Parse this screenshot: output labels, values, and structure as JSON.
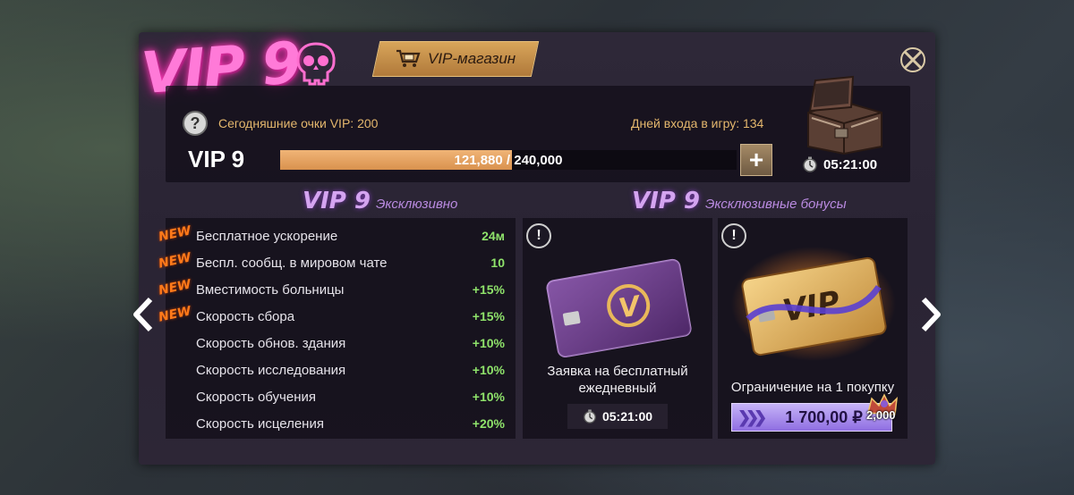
{
  "header": {
    "vip_logo_text": "VIP 9",
    "shop_label": "VIP-магазин"
  },
  "status": {
    "today_points": "Сегодняшние очки VIP: 200",
    "login_days": "Дней входа в игру: 134",
    "vip_level": "VIP 9",
    "progress_text": "121,880 / 240,000",
    "progress_fraction": 0.508,
    "plus_label": "+",
    "chest_timer": "05:21:00"
  },
  "exclusive": {
    "title_big": "VIP 9",
    "title_small": "Эксклюзивно",
    "new_label": "NEW",
    "rows": [
      {
        "name": "Бесплатное ускорение",
        "value": "24м",
        "is_new": true
      },
      {
        "name": "Беспл. сообщ. в мировом чате",
        "value": "10",
        "is_new": true
      },
      {
        "name": "Вместимость больницы",
        "value": "+15%",
        "is_new": true
      },
      {
        "name": "Скорость сбора",
        "value": "+15%",
        "is_new": true
      },
      {
        "name": "Скорость обнов. здания",
        "value": "+10%",
        "is_new": false
      },
      {
        "name": "Скорость исследования",
        "value": "+10%",
        "is_new": false
      },
      {
        "name": "Скорость обучения",
        "value": "+10%",
        "is_new": false
      },
      {
        "name": "Скорость исцеления",
        "value": "+20%",
        "is_new": false
      }
    ]
  },
  "bonuses": {
    "title_big": "VIP 9",
    "title_small": "Эксклюзивные бонусы",
    "card1": {
      "warn": "!",
      "title": "Заявка на бесплатный ежедневный",
      "timer": "05:21:00",
      "card_text": "V"
    },
    "card2": {
      "warn": "!",
      "card_text": "VIP",
      "title": "Ограничение на 1 покупку",
      "price": "1 700,00 ₽",
      "badge": "2,000"
    }
  },
  "colors": {
    "accent_orange": "#d9924e",
    "bonus_green": "#8fe36b",
    "vip_pink": "#ff7ad8",
    "title_purple": "#d4a4f0"
  }
}
